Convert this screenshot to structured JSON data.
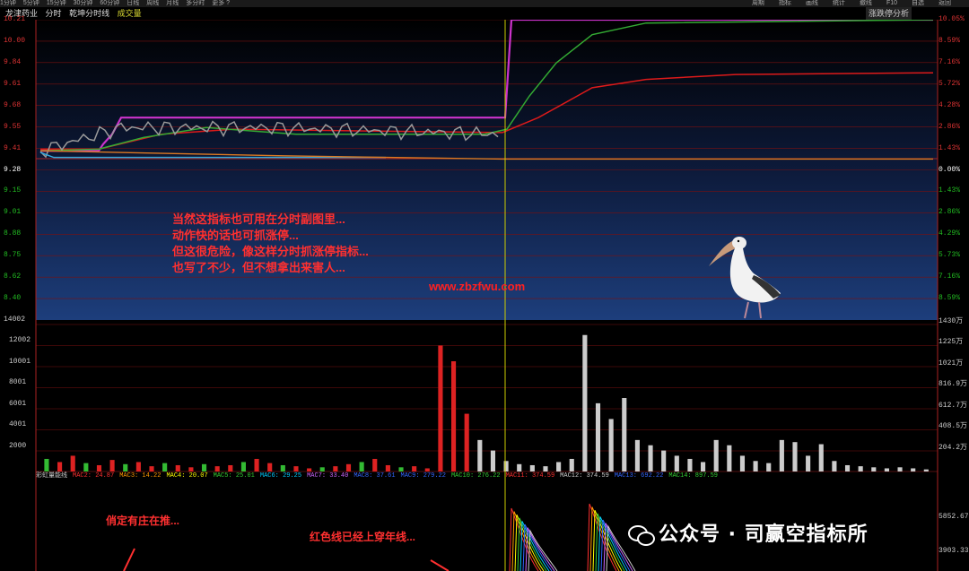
{
  "toolbar": {
    "left_items": [
      "1分钟",
      "5分钟",
      "15分钟",
      "30分钟",
      "60分钟",
      "日线",
      "周线",
      "月线",
      "多分时",
      "更多 ?"
    ],
    "right_items": [
      "周期",
      "指标",
      "画线",
      "统计",
      "撤线",
      "F10",
      "自选",
      "返回"
    ]
  },
  "subbar": {
    "stock": "龙津药业",
    "mode": "分时",
    "indicator": "乾坤分时线",
    "volume_label": "成交量",
    "right_label": "涨跌停分析"
  },
  "price_axis": {
    "left": [
      "10.21",
      "10.00",
      "9.84",
      "9.61",
      "9.68",
      "9.55",
      "9.41",
      "9.28",
      "9.15",
      "9.01",
      "8.88",
      "8.75",
      "8.62",
      "8.40",
      "14002"
    ],
    "right": [
      "10.05%",
      "8.59%",
      "7.16%",
      "5.72%",
      "4.28%",
      "2.86%",
      "1.43%",
      "0.00%",
      "1.43%",
      "2.86%",
      "4.29%",
      "5.73%",
      "7.16%",
      "8.59%",
      "1430万"
    ]
  },
  "volume_axis": {
    "left": [
      "12002",
      "10001",
      "8001",
      "6001",
      "4001",
      "2000"
    ],
    "right": [
      "1225万",
      "1021万",
      "816.9万",
      "612.7万",
      "408.5万",
      "204.2万"
    ]
  },
  "annotation_main": [
    "当然这指标也可用在分时副图里...",
    "动作快的话也可抓涨停...",
    "但这很危险，像这样分时抓涨停指标...",
    "也写了不少，但不想拿出来害人..."
  ],
  "site_watermark": "www.zbzfwu.com",
  "annotation_left": "俏定有庄在推...",
  "annotation_mid": "红色线已经上穿年线...",
  "wechat_watermark": "公众号 · 司赢空指标所",
  "bottom_axis_right": [
    "5852.67",
    "3903.33"
  ],
  "mac_bar": [
    {
      "label": "彩虹量能线",
      "color": "#cccccc"
    },
    {
      "label": "MAC2: 24.87",
      "color": "#ff3030"
    },
    {
      "label": "MAC3: 14.22",
      "color": "#ff9900"
    },
    {
      "label": "MAC4: 20.07",
      "color": "#ffff00"
    },
    {
      "label": "MAC5: 25.01",
      "color": "#33cc33"
    },
    {
      "label": "MAC6: 29.25",
      "color": "#00ccff"
    },
    {
      "label": "MAC7: 33.40",
      "color": "#cc66ff"
    },
    {
      "label": "MAC8: 37.61",
      "color": "#3366ff"
    },
    {
      "label": "MAC9: 279.22",
      "color": "#3366ff"
    },
    {
      "label": "MAC10: 276.22",
      "color": "#33cc33"
    },
    {
      "label": "MAC11: 374.59",
      "color": "#ff3030"
    },
    {
      "label": "MAC12: 374.59",
      "color": "#cccccc"
    },
    {
      "label": "MAC13: 692.22",
      "color": "#3366ff"
    },
    {
      "label": "MAC14: 897.59",
      "color": "#33cc33"
    }
  ],
  "colors": {
    "price_bg_top": "#000000",
    "price_bg_bottom": "#1c3d78",
    "grid": "#7a1010",
    "purple": "#cc33cc",
    "red_line": "#dd1a1a",
    "green_line": "#33aa33",
    "gray_line": "#9a9a9a",
    "cyan_line": "#33aadd",
    "orange_line": "#dd7a22",
    "yellow_cursor": "#dddd00"
  },
  "chart_data": {
    "type": "line",
    "price_ylim": [
      8.4,
      10.21
    ],
    "prev_close": 9.28,
    "series": [
      {
        "values": [
          9.42,
          9.42,
          9.46,
          9.62,
          9.62,
          9.62,
          9.62,
          9.62,
          9.62,
          9.62,
          10.21,
          10.21,
          10.21,
          10.21,
          10.21,
          10.21,
          10.21,
          10.21
        ]
      },
      {
        "values": [
          9.43,
          9.43,
          9.52,
          9.56,
          9.55,
          9.55,
          9.54,
          9.54,
          9.47,
          9.48,
          9.69,
          9.8,
          9.88,
          9.88,
          9.89,
          9.89,
          9.89,
          9.89
        ]
      },
      {
        "values": [
          9.42,
          9.43,
          9.5,
          9.56,
          9.54,
          9.53,
          9.52,
          9.52,
          9.52,
          9.49,
          9.54,
          9.86,
          10.05,
          10.18,
          10.2,
          10.21,
          10.21,
          10.21
        ]
      },
      {
        "values": [
          9.42,
          9.42,
          9.5,
          9.55,
          9.56,
          9.56,
          9.55,
          9.55,
          9.53,
          9.5,
          9.53,
          9.7,
          9.93,
          10.12,
          10.18,
          10.2,
          10.2,
          10.21
        ]
      }
    ],
    "volume_ylim": [
      0,
      14002
    ],
    "volume_bars": [
      1200,
      900,
      1500,
      800,
      600,
      1100,
      700,
      900,
      500,
      800,
      600,
      400,
      700,
      500,
      600,
      900,
      1200,
      800,
      600,
      500,
      300,
      400,
      500,
      700,
      900,
      1200,
      600,
      400,
      500,
      300,
      12000,
      10500,
      5500,
      3000,
      2000,
      1000,
      700,
      600,
      500,
      900,
      1200,
      13000,
      6500,
      5000,
      7000,
      3000,
      2500,
      2000,
      1500,
      1200,
      900,
      3000,
      2500,
      1500,
      1000,
      800,
      3000,
      2800,
      1500,
      2600,
      1000,
      600,
      500,
      400,
      300,
      400,
      300,
      200
    ]
  }
}
